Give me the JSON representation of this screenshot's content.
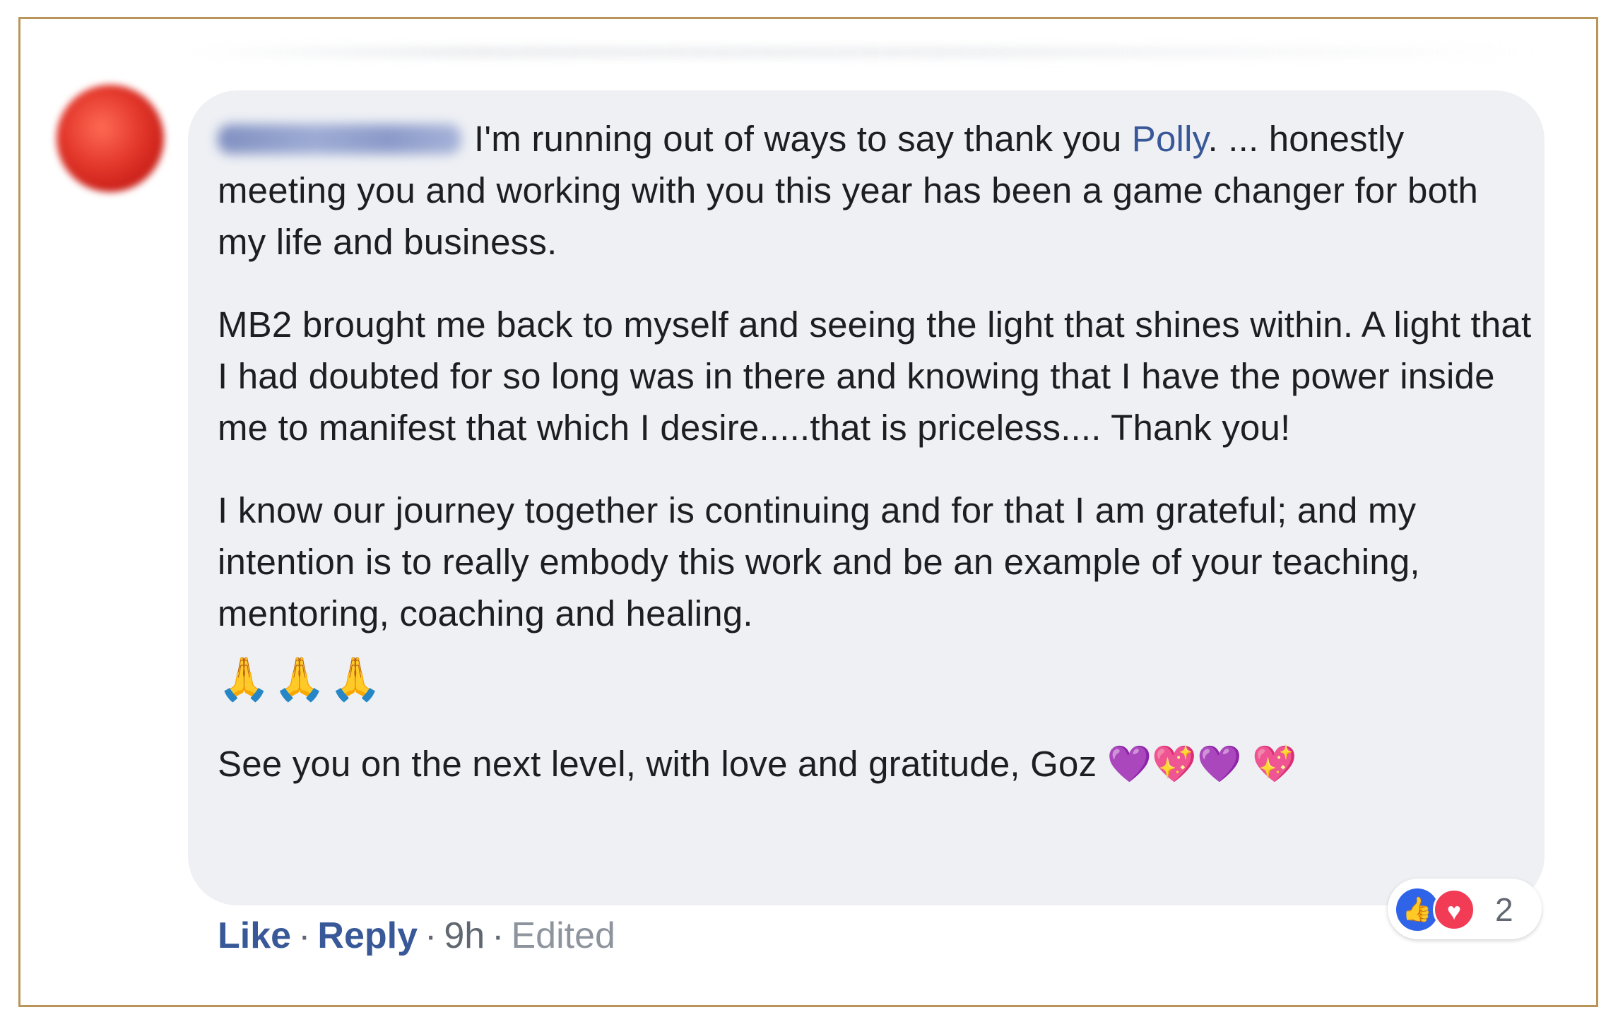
{
  "comment": {
    "author_name": "",
    "paragraphs": [
      {
        "lead": "I'm running out of ways to say thank you ",
        "mention": "Polly",
        "tail": ". ... honestly meeting you and working with you this year has been a game changer for both my life and business."
      },
      {
        "text": "MB2 brought me back to myself and seeing the light that shines within. A light that I had doubted for so long was in there and knowing that I have the power inside me to manifest that which I desire.....that is priceless.... Thank you!"
      },
      {
        "text": "I know our journey together is continuing and for that I am grateful; and my intention is to really embody this work and be an example of your teaching, mentoring, coaching and healing."
      },
      {
        "text": "See you on the next level, with love and gratitude, Goz "
      }
    ],
    "prayer_emojis": [
      "🙏",
      "🙏",
      "🙏"
    ],
    "heart_emojis": [
      "💜",
      "💖",
      "💜",
      "💖"
    ],
    "icons": {
      "avatar": "user-avatar-blurred",
      "like": "thumbs-up-icon",
      "love": "heart-icon",
      "prayer": "folded-hands-icon"
    }
  },
  "actions": {
    "like": "Like",
    "separator": "·",
    "reply": "Reply",
    "time": "9h",
    "edited": "Edited"
  },
  "reactions": {
    "like_glyph": "👍",
    "love_glyph": "♥",
    "count": "2"
  },
  "colors": {
    "frame_border": "#b9955a",
    "bubble": "#eef0f4",
    "link": "#385898",
    "like_blue": "#2f64e9",
    "love_red": "#f23b55"
  }
}
